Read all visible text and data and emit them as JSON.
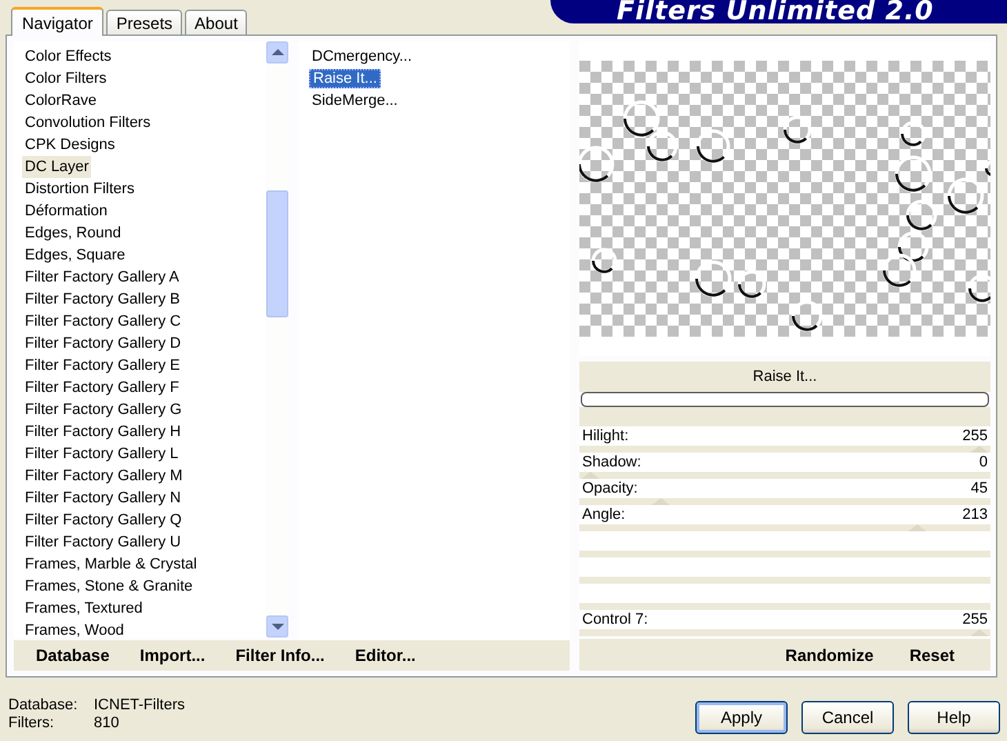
{
  "banner": {
    "title": "Filters Unlimited 2.0"
  },
  "tabs": [
    {
      "label": "Navigator",
      "selected": true
    },
    {
      "label": "Presets",
      "selected": false
    },
    {
      "label": "About",
      "selected": false
    }
  ],
  "categories": [
    {
      "label": "Color Effects",
      "selected": false
    },
    {
      "label": "Color Filters",
      "selected": false
    },
    {
      "label": "ColorRave",
      "selected": false
    },
    {
      "label": "Convolution Filters",
      "selected": false
    },
    {
      "label": "CPK Designs",
      "selected": false
    },
    {
      "label": "DC Layer",
      "selected": true
    },
    {
      "label": "Distortion Filters",
      "selected": false
    },
    {
      "label": "Déformation",
      "selected": false
    },
    {
      "label": "Edges, Round",
      "selected": false
    },
    {
      "label": "Edges, Square",
      "selected": false
    },
    {
      "label": "Filter Factory Gallery A",
      "selected": false
    },
    {
      "label": "Filter Factory Gallery B",
      "selected": false
    },
    {
      "label": "Filter Factory Gallery C",
      "selected": false
    },
    {
      "label": "Filter Factory Gallery D",
      "selected": false
    },
    {
      "label": "Filter Factory Gallery E",
      "selected": false
    },
    {
      "label": "Filter Factory Gallery F",
      "selected": false
    },
    {
      "label": "Filter Factory Gallery G",
      "selected": false
    },
    {
      "label": "Filter Factory Gallery H",
      "selected": false
    },
    {
      "label": "Filter Factory Gallery L",
      "selected": false
    },
    {
      "label": "Filter Factory Gallery M",
      "selected": false
    },
    {
      "label": "Filter Factory Gallery N",
      "selected": false
    },
    {
      "label": "Filter Factory Gallery Q",
      "selected": false
    },
    {
      "label": "Filter Factory Gallery U",
      "selected": false
    },
    {
      "label": "Frames, Marble & Crystal",
      "selected": false
    },
    {
      "label": "Frames, Stone & Granite",
      "selected": false
    },
    {
      "label": "Frames, Textured",
      "selected": false
    },
    {
      "label": "Frames, Wood",
      "selected": false
    }
  ],
  "filters": [
    {
      "label": "DCmergency...",
      "selected": false
    },
    {
      "label": "Raise It...",
      "selected": true
    },
    {
      "label": "SideMerge...",
      "selected": false
    }
  ],
  "preview": {
    "filter_name": "Raise It...",
    "progress": {
      "level": 0
    }
  },
  "controls": [
    {
      "kind": "slider",
      "label": "Hilight:",
      "value": "255",
      "level": 1
    },
    {
      "kind": "slider",
      "label": "Shadow:",
      "value": "0",
      "level": 0
    },
    {
      "kind": "slider",
      "label": "Opacity:",
      "value": "45",
      "level": 0.18
    },
    {
      "kind": "slider",
      "label": "Angle:",
      "value": "213",
      "level": 0.84
    },
    {
      "kind": "empty"
    },
    {
      "kind": "empty"
    },
    {
      "kind": "empty"
    },
    {
      "kind": "slider",
      "label": "Control 7:",
      "value": "255",
      "level": 1
    }
  ],
  "left_buttons": [
    "Database",
    "Import...",
    "Filter Info...",
    "Editor..."
  ],
  "right_buttons": [
    "Randomize",
    "Reset"
  ],
  "status": [
    {
      "label": "Database:",
      "value": "ICNET-Filters"
    },
    {
      "label": "Filters:",
      "value": "810"
    }
  ],
  "dialog_buttons": [
    {
      "label": "Apply",
      "default": true
    },
    {
      "label": "Cancel",
      "default": false
    },
    {
      "label": "Help",
      "default": false
    }
  ]
}
